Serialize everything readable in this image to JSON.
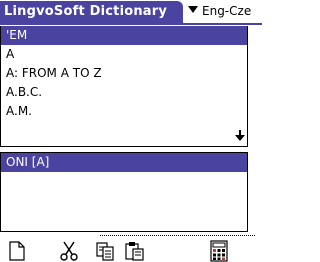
{
  "app": {
    "title": "LingvoSoft Dictionary"
  },
  "language_select": {
    "selected": "Eng-Cze"
  },
  "word_list": {
    "items": [
      {
        "text": "'EM",
        "selected": true
      },
      {
        "text": "A",
        "selected": false
      },
      {
        "text": "A: FROM A TO Z",
        "selected": false
      },
      {
        "text": "A.B.C.",
        "selected": false
      },
      {
        "text": "A.M.",
        "selected": false
      }
    ]
  },
  "translation": {
    "text": "ONI [A]"
  },
  "toolbar": {
    "icons": [
      "new-document-icon",
      "cut-icon",
      "copy-icon",
      "paste-icon",
      "calculator-icon"
    ]
  },
  "colors": {
    "accent": "#4a44a0",
    "background": "#ffffff",
    "text": "#000000"
  }
}
